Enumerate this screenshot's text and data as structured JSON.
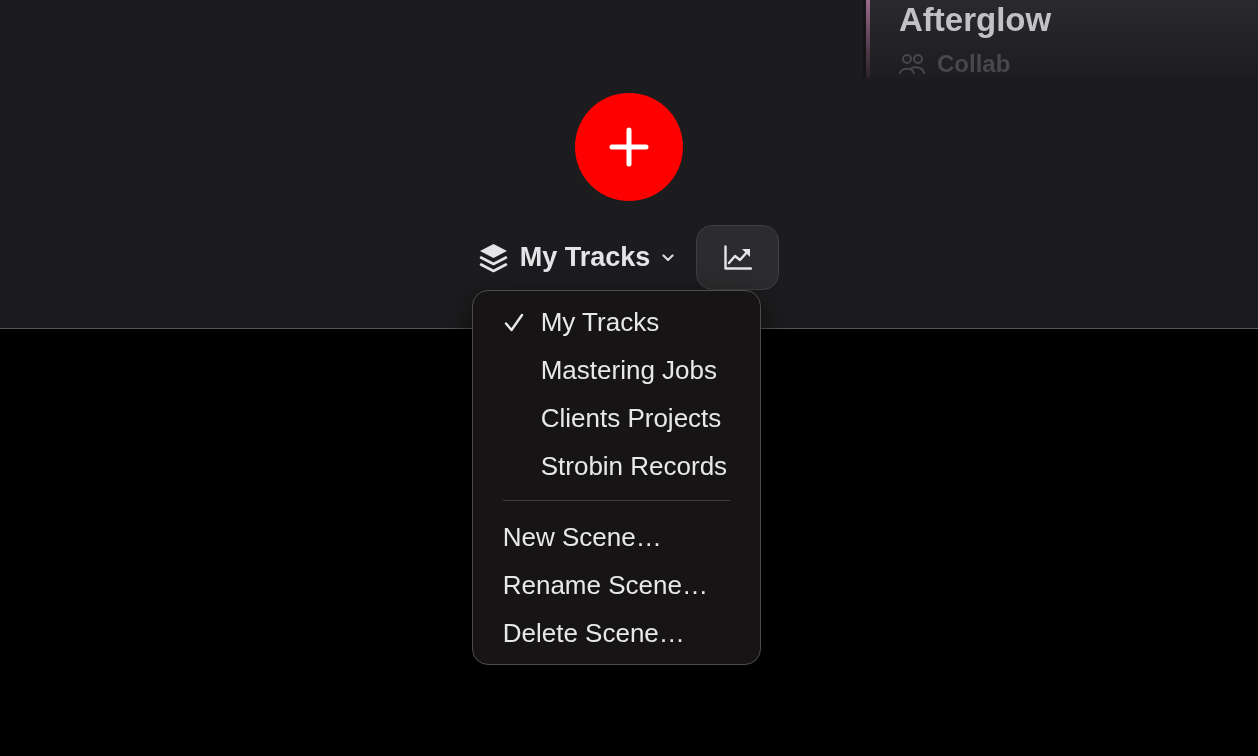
{
  "card": {
    "title": "Afterglow",
    "subtitle": "Collab"
  },
  "scene_picker": {
    "label": "My Tracks",
    "expanded": true
  },
  "menu": {
    "scenes": [
      {
        "label": "My Tracks",
        "selected": true
      },
      {
        "label": "Mastering Jobs",
        "selected": false
      },
      {
        "label": "Clients Projects",
        "selected": false
      },
      {
        "label": "Strobin Records",
        "selected": false
      }
    ],
    "actions": [
      "New Scene…",
      "Rename Scene…",
      "Delete Scene…"
    ]
  }
}
